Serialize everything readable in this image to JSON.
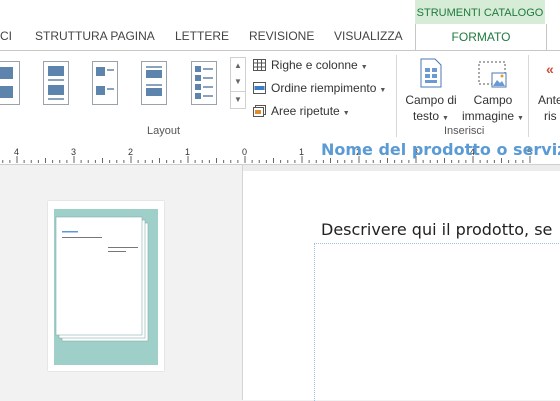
{
  "tabs": {
    "partial_left": "CI",
    "items": [
      "STRUTTURA PAGINA",
      "LETTERE",
      "REVISIONE",
      "VISUALIZZA"
    ],
    "contextual_header": "STRUMENTI CATALOGO",
    "active": "FORMATO"
  },
  "ribbon": {
    "layout_group": {
      "label": "Layout",
      "commands": [
        {
          "label": "Righe e colonne",
          "icon": "table-grid-icon"
        },
        {
          "label": "Ordine riempimento",
          "icon": "fill-order-icon"
        },
        {
          "label": "Aree ripetute",
          "icon": "repeat-areas-icon"
        }
      ]
    },
    "insert_group": {
      "label": "Inserisci",
      "text_field": {
        "line1": "Campo di",
        "line2": "testo"
      },
      "image_field": {
        "line1": "Campo",
        "line2": "immagine"
      },
      "partial_button": {
        "line1": "Ante",
        "line2": "ris"
      }
    }
  },
  "ruler": {
    "labels": [
      "4",
      "3",
      "2",
      "1",
      "0",
      "1",
      "2",
      "3",
      "4",
      "5"
    ],
    "zero_index": 4
  },
  "document": {
    "title": "Nome del prodotto o servizio",
    "description": "Descrivere qui il prodotto, se"
  },
  "colors": {
    "accent_green": "#1f7a3e",
    "contextual_bg": "#d6ecd6",
    "title_blue": "#5b9bd5",
    "thumb_teal": "#9ecfc9"
  }
}
